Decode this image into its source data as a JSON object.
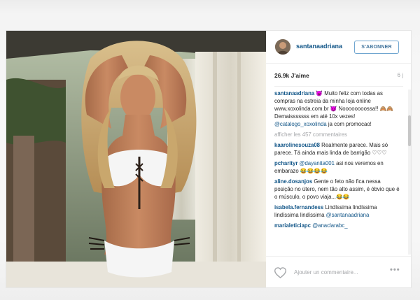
{
  "post": {
    "username": "santanaadriana",
    "follow_label": "S'ABONNER",
    "likes": "26.9k J'aime",
    "time_ago": "6 j",
    "caption": {
      "user": "santanaadriana",
      "text": " 😈 Muito feliz com todas as compras na estreia da minha loja online www.xoxolinda.com.br 😈 Noooooooossa!! 🙈🙈 Demaisssssss em até 10x vezes! ",
      "tag": "@catalogo_xoxolinda",
      "text_after": " ja com promocao!"
    },
    "load_more": "afficher les 457 commentaires",
    "comments": [
      {
        "user": "kaarolinesouza08",
        "text": " Realmente parece. Mais só parece. Tá ainda mais linda de barrigão ♡♡♡",
        "tag": ""
      },
      {
        "user": "pcharityr",
        "text": " asi nos veremos en embarazo 😂😂😂😂",
        "tag": "@dayanita001"
      },
      {
        "user": "aline.dosanjos",
        "text": " Gente o feto não fica nessa posição no útero, nem tão alto assim, é óbvio que é o músculo, o povo viaja...😂😂",
        "tag": ""
      },
      {
        "user": "isabela.fernandess",
        "text": " Lindíssima lindíssima lindíssima lindíssima ",
        "tag": "@santanaadriana"
      },
      {
        "user": "marialeticiapc",
        "text": " ",
        "tag": "@anaclarabc_"
      }
    ],
    "comment_placeholder": "Ajouter un commentaire...",
    "more_options": "•••"
  },
  "icons": {
    "like": "heart-outline-icon",
    "more": "more-options-icon"
  },
  "colors": {
    "link_blue": "#125688",
    "follow_blue": "#3f729b",
    "text": "#262626",
    "muted": "#a5a7aa"
  }
}
